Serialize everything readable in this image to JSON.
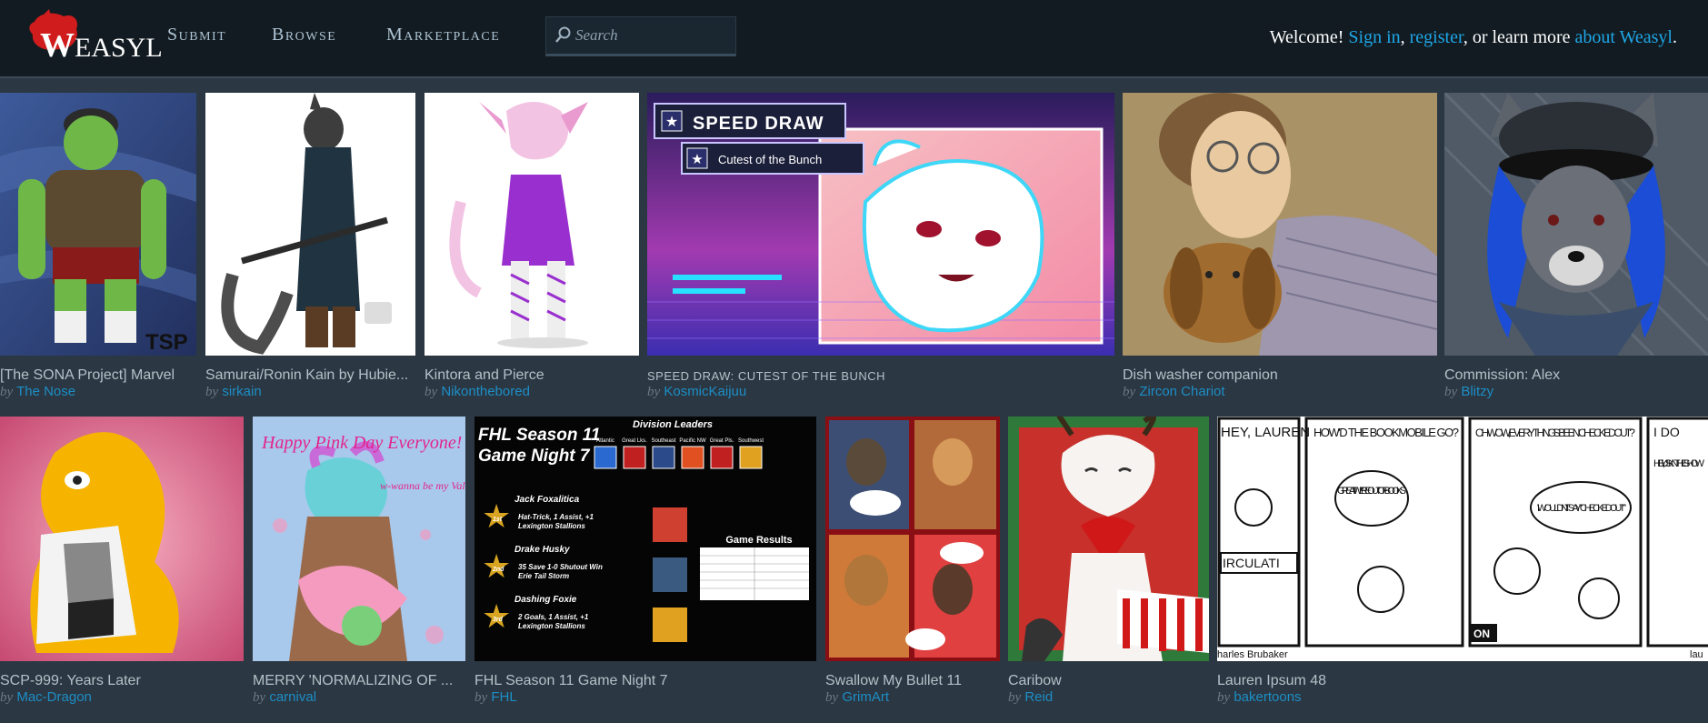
{
  "header": {
    "logo_big": "W",
    "logo_rest": "EASYL",
    "nav": [
      {
        "label": "Submit"
      },
      {
        "label": "Browse"
      },
      {
        "label": "Marketplace"
      }
    ],
    "search": {
      "placeholder": "Search"
    },
    "welcome": {
      "prefix": "Welcome!",
      "sign_in": "Sign in",
      "sep1": ",",
      "register": "register",
      "middle": ", or learn more",
      "about": "about Weasyl",
      "suffix": "."
    }
  },
  "byline_prefix": "by",
  "row1": [
    {
      "title": "[The SONA Project] Marvel",
      "artist": "The Nose",
      "overlay": "TSP"
    },
    {
      "title": "Samurai/Ronin Kain by Hubie...",
      "artist": "sirkain"
    },
    {
      "title": "Kintora and Pierce",
      "artist": "Nikonthebored"
    },
    {
      "title": "SPEED DRAW: CUTEST OF THE BUNCH",
      "artist": "KosmicKaijuu",
      "overlay_1": "SPEED DRAW",
      "overlay_2": "Cutest of the Bunch"
    },
    {
      "title": "Dish washer companion",
      "artist": "Zircon Chariot"
    },
    {
      "title": "Commission: Alex",
      "artist": "Blitzy"
    }
  ],
  "row2": [
    {
      "title": "SCP-999: Years Later",
      "artist": "Mac-Dragon"
    },
    {
      "title": "MERRY 'NORMALIZING OF ...",
      "artist": "carnival",
      "overlay_1": "Happy Pink Day Everyone!",
      "overlay_2": "w-wanna be my Valentine?"
    },
    {
      "title": "FHL Season 11 Game Night 7",
      "artist": "FHL",
      "poster": {
        "heading_1": "FHL Season 11",
        "heading_2": "Game Night 7",
        "division_title": "Division Leaders",
        "divisions": [
          "Atlantic",
          "Great Lks.",
          "Southeast",
          "Pacific NW",
          "Great Pls.",
          "Southwest"
        ],
        "stars": [
          {
            "rank": "1st",
            "name": "Jack Foxalitica",
            "line1": "Hat-Trick, 1 Assist, +1",
            "line2": "Lexington Stallions"
          },
          {
            "rank": "2nd",
            "name": "Drake Husky",
            "line1": "35 Save 1-0 Shutout Win",
            "line2": "Erie Tail Storm"
          },
          {
            "rank": "3rd",
            "name": "Dashing Foxie",
            "line1": "2 Goals, 1 Assist, +1",
            "line2": "Lexington Stallions"
          }
        ],
        "results_title": "Game Results"
      }
    },
    {
      "title": "Swallow My Bullet 11",
      "artist": "GrimArt"
    },
    {
      "title": "Caribow",
      "artist": "Reid"
    },
    {
      "title": "Lauren Ipsum 48",
      "artist": "bakertoons",
      "comic": {
        "p1": "HEY, LAUREN",
        "p2a": "HOW'D THE BOOKMOBILE GO?",
        "p2b": "GREAT! WE'RE OUT OF BOOKS",
        "p3a": "OH WOW, EVERYTHING'S BEEN CHECKED OUT?",
        "p3b": "I WOULDN'T SAY \"CHECKED OUT\"",
        "p4a": "I DO",
        "p4b": "HEY, US KN THE SHOW",
        "sign": "IRCULATI",
        "credit": "harles Brubaker",
        "credit2": "lau",
        "on": "ON"
      }
    }
  ]
}
